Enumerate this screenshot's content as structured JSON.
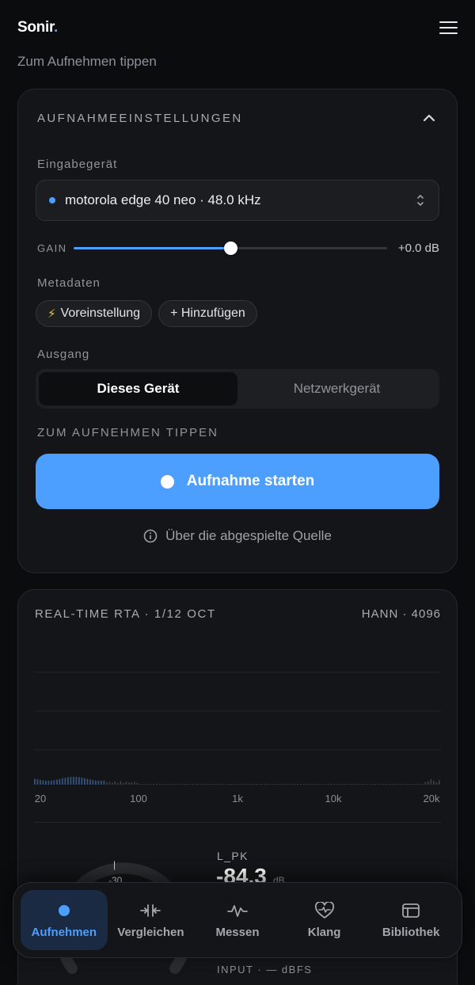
{
  "app": {
    "logo_main": "Sonir",
    "logo_dot": "."
  },
  "subtitle": "Zum Aufnehmen tippen",
  "settings": {
    "title": "AUFNAHMEEINSTELLUNGEN",
    "input_label": "Eingabegerät",
    "device": "motorola edge 40 neo · 48.0 kHz",
    "gain_label": "GAIN",
    "gain_value": "+0.0 dB",
    "gain_level": 0.5,
    "metadata_label": "Metadaten",
    "chip_preset": "Voreinstellung",
    "chip_add": "+ Hinzufügen",
    "output_label": "Ausgang",
    "output_options": [
      "Dieses Gerät",
      "Netzwerkgerät"
    ],
    "record_hint": "ZUM AUFNEHMEN TIPPEN",
    "record_button": "Aufnahme starten",
    "source_link": "Über die abgespielte Quelle"
  },
  "rta": {
    "title": "REAL-TIME RTA · 1/12 OCT",
    "meta": "HANN · 4096",
    "freq_labels": [
      "20",
      "100",
      "1k",
      "10k",
      "20k"
    ],
    "gauge_ticks": [
      "|",
      "-30"
    ],
    "lpk_label": "L_PK",
    "lpk_value": "-84.3",
    "lpk_unit": "dB",
    "input_readout": "INPUT · — dBFS"
  },
  "tabs": [
    {
      "label": "Aufnehmen",
      "icon": "record-dot-icon"
    },
    {
      "label": "Vergleichen",
      "icon": "compare-icon"
    },
    {
      "label": "Messen",
      "icon": "waveform-icon"
    },
    {
      "label": "Klang",
      "icon": "heart-pulse-icon"
    },
    {
      "label": "Bibliothek",
      "icon": "library-icon"
    }
  ],
  "colors": {
    "accent": "#4c9eff",
    "background": "#0b0c0e",
    "card": "#141518"
  }
}
